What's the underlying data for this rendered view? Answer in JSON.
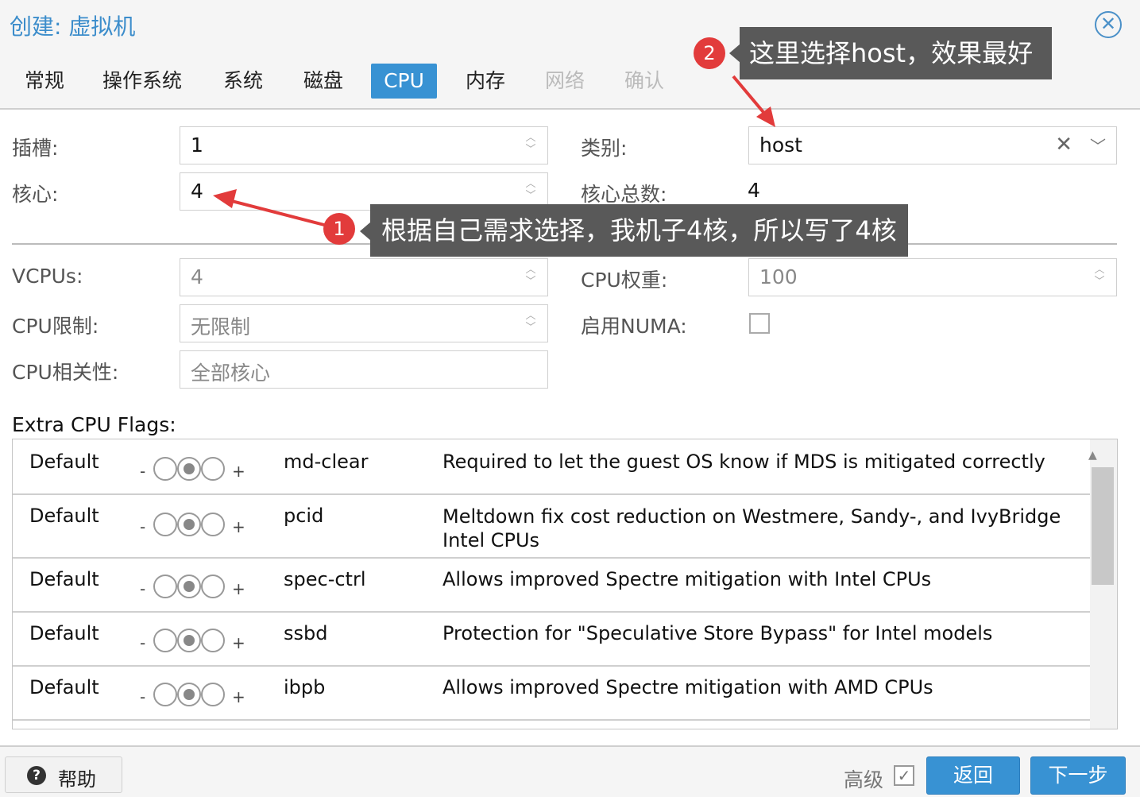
{
  "window": {
    "title": "创建: 虚拟机",
    "close_glyph": "✕"
  },
  "tabs": [
    {
      "label": "常规",
      "state": "normal"
    },
    {
      "label": "操作系统",
      "state": "normal"
    },
    {
      "label": "系统",
      "state": "normal"
    },
    {
      "label": "磁盘",
      "state": "normal"
    },
    {
      "label": "CPU",
      "state": "active"
    },
    {
      "label": "内存",
      "state": "normal"
    },
    {
      "label": "网络",
      "state": "disabled"
    },
    {
      "label": "确认",
      "state": "disabled"
    }
  ],
  "form": {
    "sockets": {
      "label": "插槽:",
      "value": "1"
    },
    "cores": {
      "label": "核心:",
      "value": "4"
    },
    "type": {
      "label": "类别:",
      "value": "host"
    },
    "total_cores": {
      "label": "核心总数:",
      "value": "4"
    },
    "vcpus": {
      "label": "VCPUs:",
      "value": "4"
    },
    "cpu_units": {
      "label": "CPU权重:",
      "value": "100"
    },
    "cpu_limit": {
      "label": "CPU限制:",
      "placeholder": "无限制"
    },
    "numa": {
      "label": "启用NUMA:",
      "checked": false
    },
    "cpu_affinity": {
      "label": "CPU相关性:",
      "placeholder": "全部核心"
    }
  },
  "flags": {
    "title": "Extra CPU Flags:",
    "rows": [
      {
        "state": "Default",
        "name": "md-clear",
        "desc": "Required to let the guest OS know if MDS is mitigated correctly"
      },
      {
        "state": "Default",
        "name": "pcid",
        "desc": "Meltdown fix cost reduction on Westmere, Sandy-, and IvyBridge Intel CPUs"
      },
      {
        "state": "Default",
        "name": "spec-ctrl",
        "desc": "Allows improved Spectre mitigation with Intel CPUs"
      },
      {
        "state": "Default",
        "name": "ssbd",
        "desc": "Protection for \"Speculative Store Bypass\" for Intel models"
      },
      {
        "state": "Default",
        "name": "ibpb",
        "desc": "Allows improved Spectre mitigation with AMD CPUs"
      }
    ],
    "minus": "-",
    "plus": "+"
  },
  "footer": {
    "help_label": "帮助",
    "help_glyph": "?",
    "advanced_label": "高级",
    "advanced_checked": true,
    "back_label": "返回",
    "next_label": "下一步"
  },
  "annotations": [
    {
      "badge": "1",
      "text": "根据自己需求选择，我机子4核，所以写了4核"
    },
    {
      "badge": "2",
      "text": "这里选择host，效果最好"
    }
  ],
  "colors": {
    "accent": "#3892d3",
    "title": "#3c8dcb",
    "annotation_badge": "#e23b3b",
    "annotation_bubble": "#595959"
  }
}
